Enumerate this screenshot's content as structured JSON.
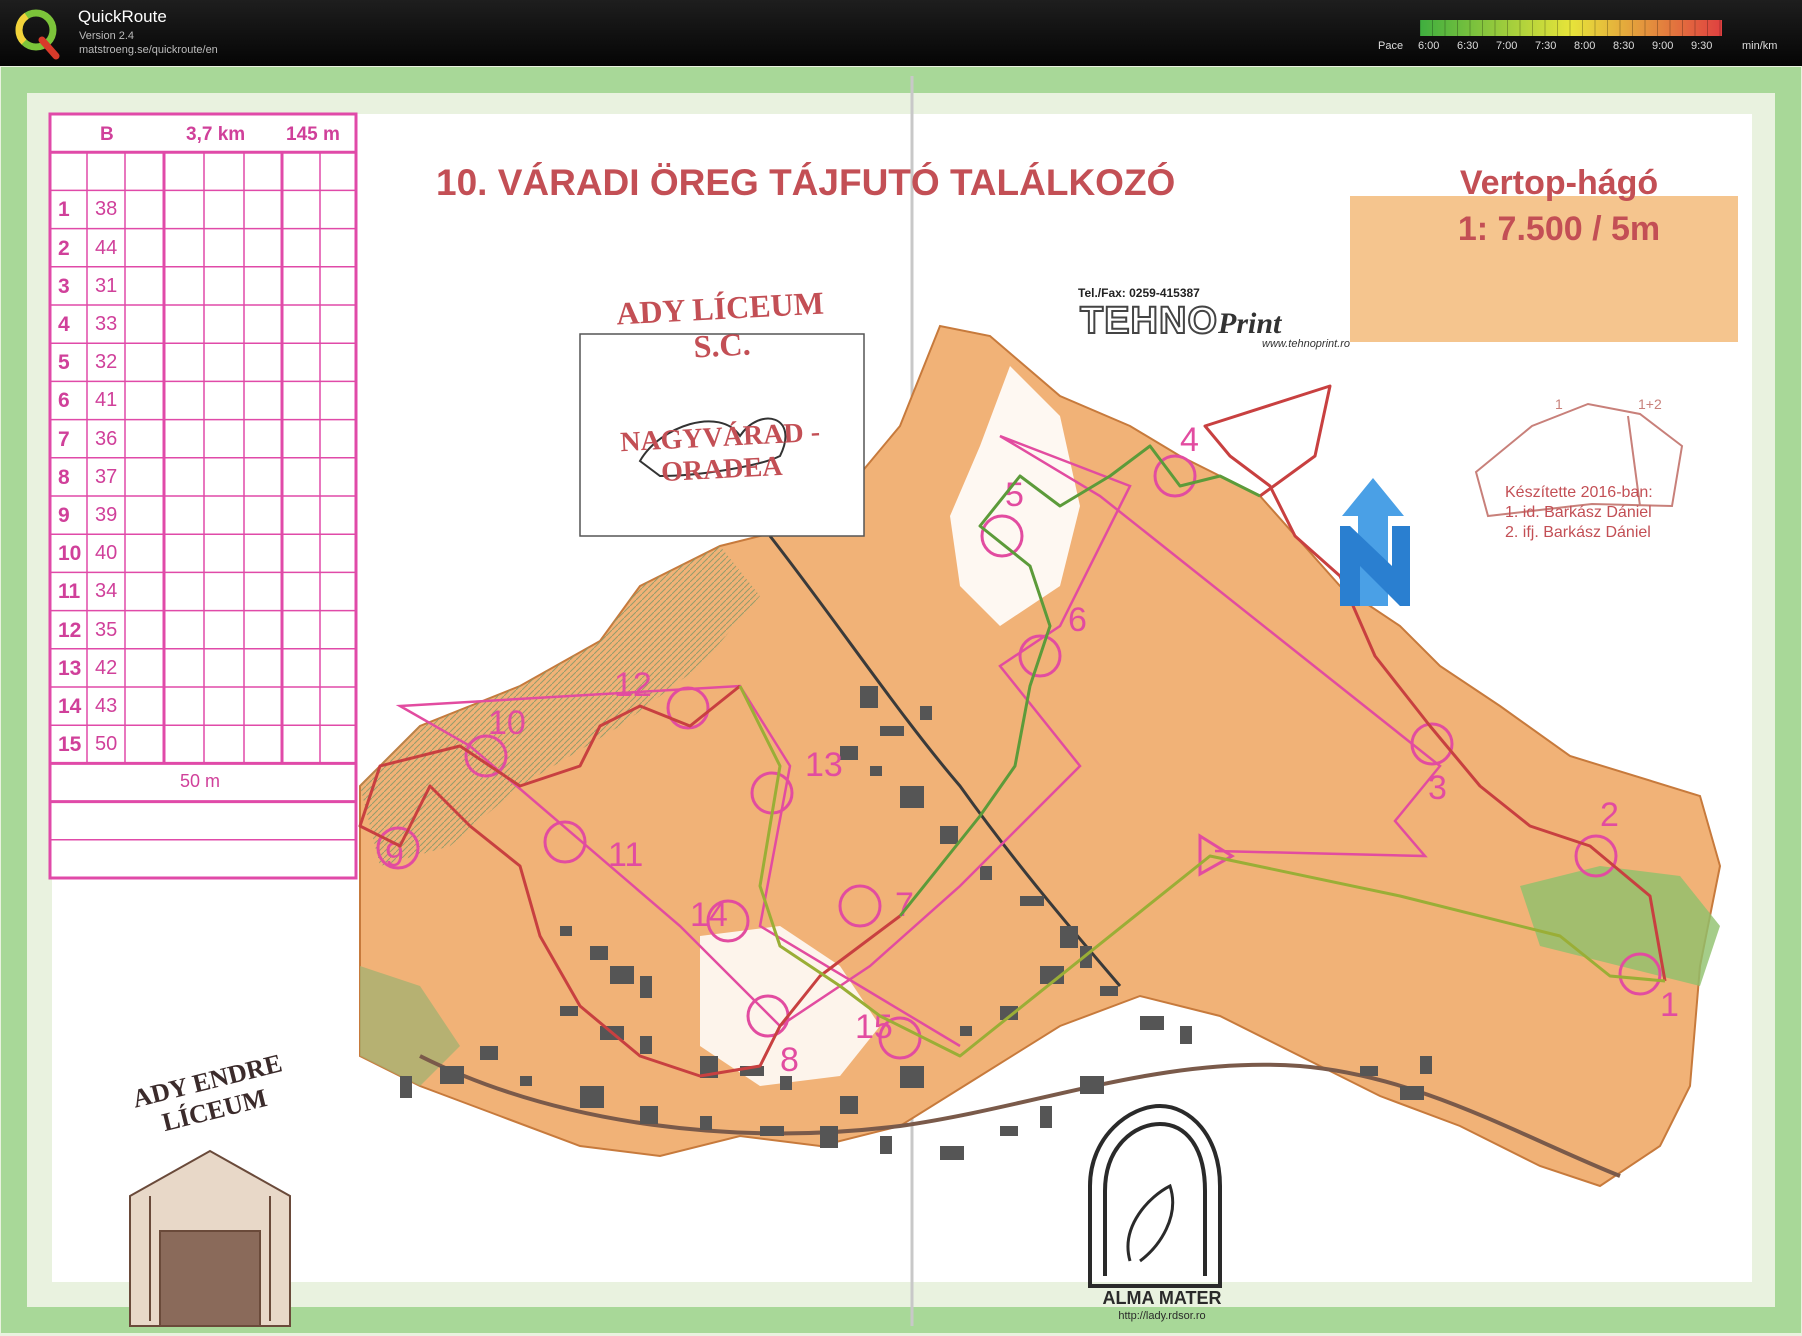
{
  "app": {
    "name": "QuickRoute",
    "version": "Version 2.4",
    "url": "matstroeng.se/quickroute/en"
  },
  "pace_scale": {
    "label": "Pace",
    "unit": "min/km",
    "ticks": [
      "6:00",
      "6:30",
      "7:00",
      "7:30",
      "8:00",
      "8:30",
      "9:00",
      "9:30"
    ],
    "color_low": "#3fae3f",
    "color_mid": "#e7e43a",
    "color_high": "#e04040"
  },
  "map": {
    "title": "10. VÁRADI ÖREG TÁJFUTÓ TALÁLKOZÓ",
    "area_name": "Vertop-hágó",
    "scale": "1: 7.500 / 5m",
    "credits_title": "Készítette 2016-ban:",
    "credits": [
      "1. id. Barkász Dániel",
      "2. ifj. Barkász Dániel"
    ],
    "inset_labels": [
      "1",
      "1+2"
    ],
    "sponsor_phone": "Tel./Fax: 0259-415387",
    "sponsor_brand_a": "TEHNO",
    "sponsor_brand_b": "Print",
    "sponsor_url": "www.tehnoprint.ro",
    "club_top": "ADY LÍCEUM S.C.",
    "club_bottom": "NAGYVÁRAD - ORADEA",
    "school": "ADY ENDRE LÍCEUM",
    "alma_mater": "ALMA MATER",
    "alma_url": "http://lady.rdsor.ro",
    "control_numbers": [
      "1",
      "2",
      "3",
      "4",
      "5",
      "6",
      "7",
      "8",
      "9",
      "10",
      "11",
      "12",
      "13",
      "14",
      "15"
    ]
  },
  "description_sheet": {
    "class": "B",
    "length": "3,7 km",
    "climb": "145 m",
    "finish_distance": "50 m",
    "rows": [
      {
        "n": "1",
        "code": "38"
      },
      {
        "n": "2",
        "code": "44"
      },
      {
        "n": "3",
        "code": "31"
      },
      {
        "n": "4",
        "code": "33"
      },
      {
        "n": "5",
        "code": "32"
      },
      {
        "n": "6",
        "code": "41"
      },
      {
        "n": "7",
        "code": "36"
      },
      {
        "n": "8",
        "code": "37"
      },
      {
        "n": "9",
        "code": "39"
      },
      {
        "n": "10",
        "code": "40"
      },
      {
        "n": "11",
        "code": "34"
      },
      {
        "n": "12",
        "code": "35"
      },
      {
        "n": "13",
        "code": "42"
      },
      {
        "n": "14",
        "code": "43"
      },
      {
        "n": "15",
        "code": "50"
      }
    ]
  }
}
